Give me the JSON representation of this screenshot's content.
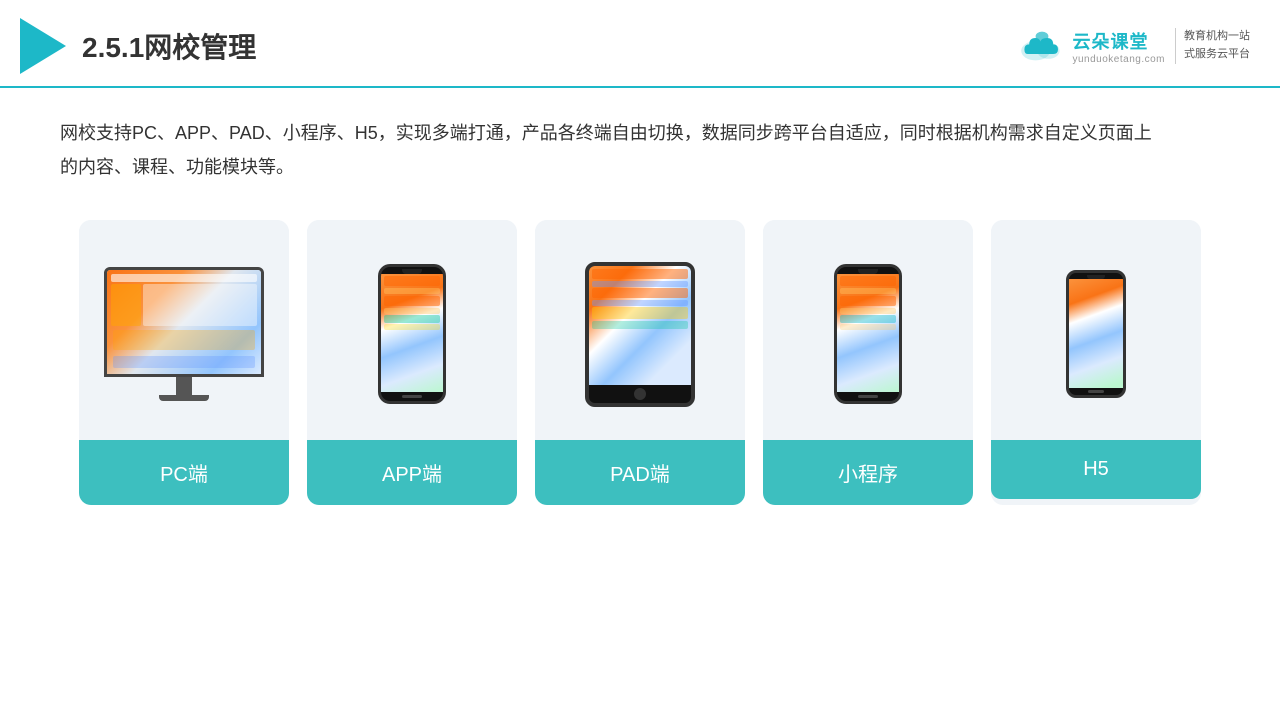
{
  "header": {
    "title": "2.5.1网校管理",
    "brand": {
      "name": "云朵课堂",
      "url": "yunduoketang.com",
      "slogan": "教育机构一站\n式服务云平台"
    }
  },
  "description": "网校支持PC、APP、PAD、小程序、H5，实现多端打通，产品各终端自由切换，数据同步跨平台自适应，同时根据机构需求自定义页面上的内容、课程、功能模块等。",
  "cards": [
    {
      "id": "pc",
      "label": "PC端"
    },
    {
      "id": "app",
      "label": "APP端"
    },
    {
      "id": "pad",
      "label": "PAD端"
    },
    {
      "id": "miniprogram",
      "label": "小程序"
    },
    {
      "id": "h5",
      "label": "H5"
    }
  ]
}
